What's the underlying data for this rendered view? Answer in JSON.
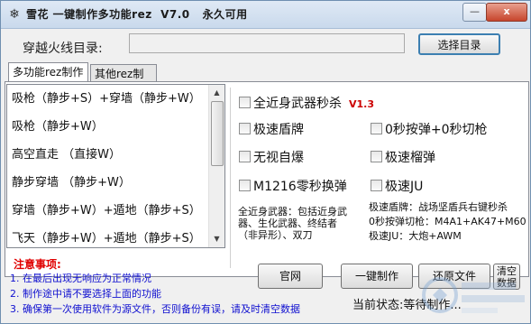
{
  "window": {
    "title": "雪花 一键制作多功能rez  V7.0   永久可用",
    "minimize_glyph": "—",
    "close_glyph": "x"
  },
  "directory": {
    "label": "穿越火线目录:",
    "value": "",
    "select_button": "选择目录"
  },
  "tabs": [
    {
      "label": "多功能rez制作",
      "active": true
    },
    {
      "label": "其他rez制作",
      "active": false
    }
  ],
  "mode_list": [
    "吸枪（静步+S）+穿墙（静步+W）",
    "吸枪（静步+W）",
    "高空直走 （直接W）",
    "静步穿墙 （静步+W）",
    "穿墙（静步+W）+遁地（静步+S）",
    "飞天（静步+W）+遁地（静步+S）"
  ],
  "options": {
    "all_weapon": "全近身武器秒杀",
    "version": "V1.3",
    "fast_shield": "极速盾牌",
    "zero_reload": "0秒按弹+0秒切枪",
    "no_self_explode": "无视自爆",
    "fast_grenade": "极速榴弹",
    "m1216": "M1216零秒换弹",
    "fast_ju": "极速JU"
  },
  "descriptions": {
    "left": "全近身武器：包括近身武器、生化武器、终结者（非异形）、双刀",
    "right_lines": [
      "极速盾牌：战场坚盾兵右键秒杀",
      "0秒按弹切枪：M4A1+AK47+M60",
      "极速JU：大炮+AWM"
    ]
  },
  "notes": {
    "title": "注意事项:",
    "items": [
      "1. 在最后出现无响应为正常情况",
      "2. 制作途中请不要选择上面的功能",
      "3. 确保第一次使用软件为源文件，否则备份有误，请及时清空数据"
    ]
  },
  "buttons": {
    "website": "官网",
    "make": "一键制作",
    "restore": "还原文件",
    "clear": "清空\n数据"
  },
  "status": {
    "text": "当前状态:等待制作..."
  },
  "colors": {
    "version": "#cc0000",
    "notes_title": "#e00000",
    "notes": "#1010d0"
  }
}
